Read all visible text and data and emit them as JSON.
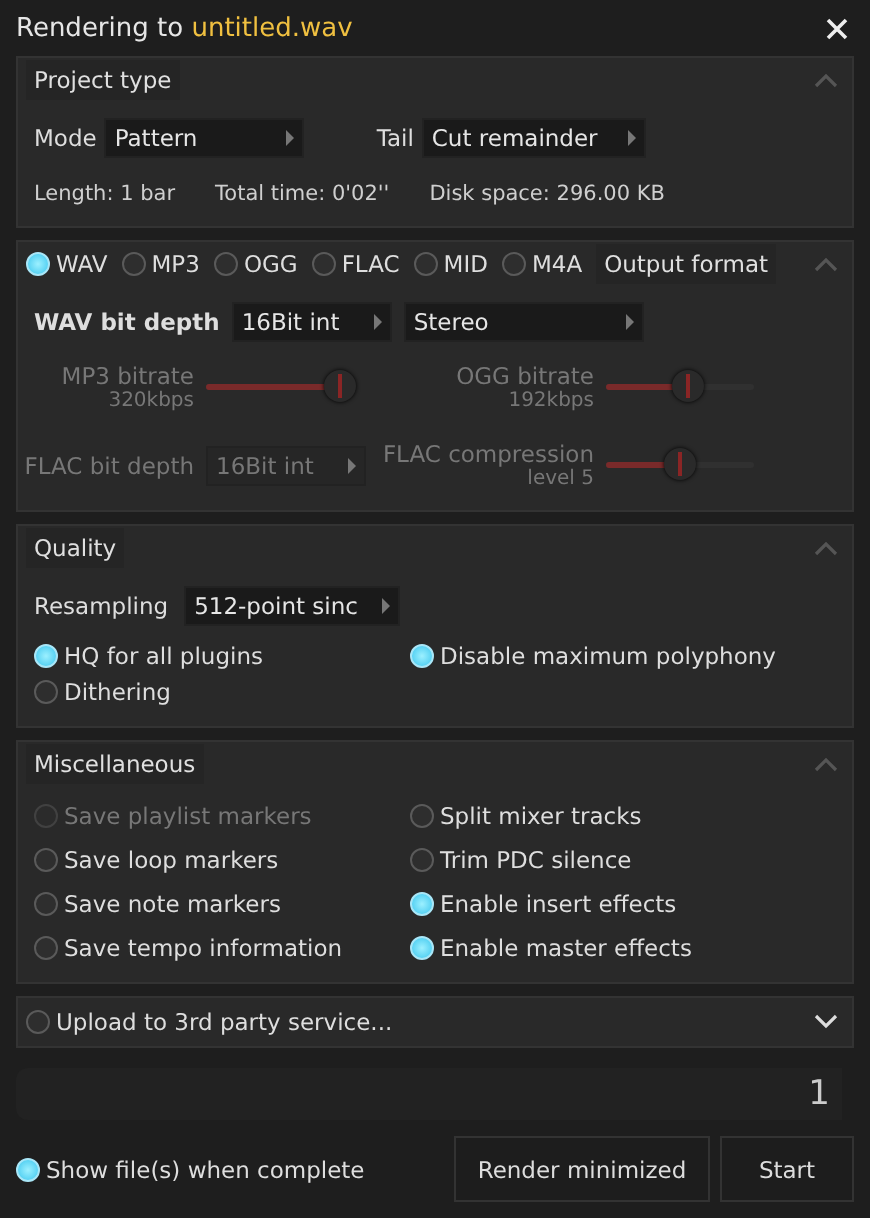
{
  "window": {
    "title_prefix": "Rendering to",
    "filename": "untitled.wav"
  },
  "project": {
    "title": "Project type",
    "expanded": true,
    "mode_label": "Mode",
    "mode": "Pattern",
    "tail_label": "Tail",
    "tail": "Cut remainder",
    "info": [
      "Length: 1 bar",
      "Total time: 0'02''",
      "Disk space: 296.00 KB"
    ]
  },
  "formats": {
    "title": "Output format",
    "expanded": true,
    "options": [
      {
        "label": "WAV",
        "selected": true
      },
      {
        "label": "MP3",
        "selected": false
      },
      {
        "label": "OGG",
        "selected": false
      },
      {
        "label": "FLAC",
        "selected": false
      },
      {
        "label": "MID",
        "selected": false
      },
      {
        "label": "M4A",
        "selected": false
      }
    ],
    "wav_label": "WAV bit depth",
    "wav_depth": "16Bit int",
    "channels": "Stereo",
    "settings": [
      {
        "kind": "slider",
        "label": "MP3 bitrate",
        "reading": "320kbps",
        "level": 0.9,
        "disabled": true
      },
      {
        "kind": "slider",
        "label": "OGG bitrate",
        "reading": "192kbps",
        "level": 0.55,
        "disabled": true
      },
      {
        "kind": "dropdown",
        "label": "FLAC bit depth",
        "value": "16Bit int",
        "disabled": true
      },
      {
        "kind": "slider",
        "label": "FLAC compression",
        "reading": "level 5",
        "level": 0.5,
        "disabled": true
      }
    ]
  },
  "quality": {
    "title": "Quality",
    "expanded": true,
    "resampling_label": "Resampling",
    "resampling": "512-point sinc",
    "options": [
      {
        "label": "HQ for all plugins",
        "checked": true,
        "disabled": false
      },
      {
        "label": "Disable maximum polyphony",
        "checked": true,
        "disabled": false
      },
      {
        "label": "Dithering",
        "checked": false,
        "disabled": false
      }
    ]
  },
  "misc": {
    "title": "Miscellaneous",
    "expanded": true,
    "options": [
      {
        "label": "Save playlist markers",
        "checked": false,
        "disabled": true
      },
      {
        "label": "Split mixer tracks",
        "checked": false,
        "disabled": false
      },
      {
        "label": "Save loop markers",
        "checked": false,
        "disabled": false
      },
      {
        "label": "Trim PDC silence",
        "checked": false,
        "disabled": false
      },
      {
        "label": "Save note markers",
        "checked": false,
        "disabled": false
      },
      {
        "label": "Enable insert effects",
        "checked": true,
        "disabled": false
      },
      {
        "label": "Save tempo information",
        "checked": false,
        "disabled": false
      },
      {
        "label": "Enable master effects",
        "checked": true,
        "disabled": false
      }
    ]
  },
  "upload": {
    "label": "Upload to 3rd party service...",
    "checked": false,
    "expanded": false
  },
  "progress": {
    "level": 0,
    "reading": "1"
  },
  "footer": {
    "show_files": {
      "label": "Show file(s) when complete",
      "checked": true
    },
    "buttons": [
      "Render minimized",
      "Start"
    ]
  }
}
